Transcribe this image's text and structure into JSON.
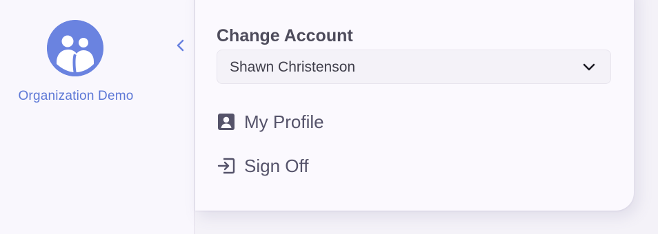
{
  "sidebar": {
    "org_name": "Organization Demo",
    "avatar_icon": "users-group-icon",
    "collapse_icon": "chevron-left-icon"
  },
  "account_menu": {
    "title": "Change Account",
    "selected_account": "Shawn Christenson",
    "items": [
      {
        "label": "My Profile",
        "icon": "profile-card-icon"
      },
      {
        "label": "Sign Off",
        "icon": "sign-out-icon"
      }
    ]
  },
  "colors": {
    "accent": "#6a83e0",
    "text_dark": "#4e4c5c",
    "panel_bg": "#fbf9fe",
    "page_bg": "#f4f2f8"
  }
}
